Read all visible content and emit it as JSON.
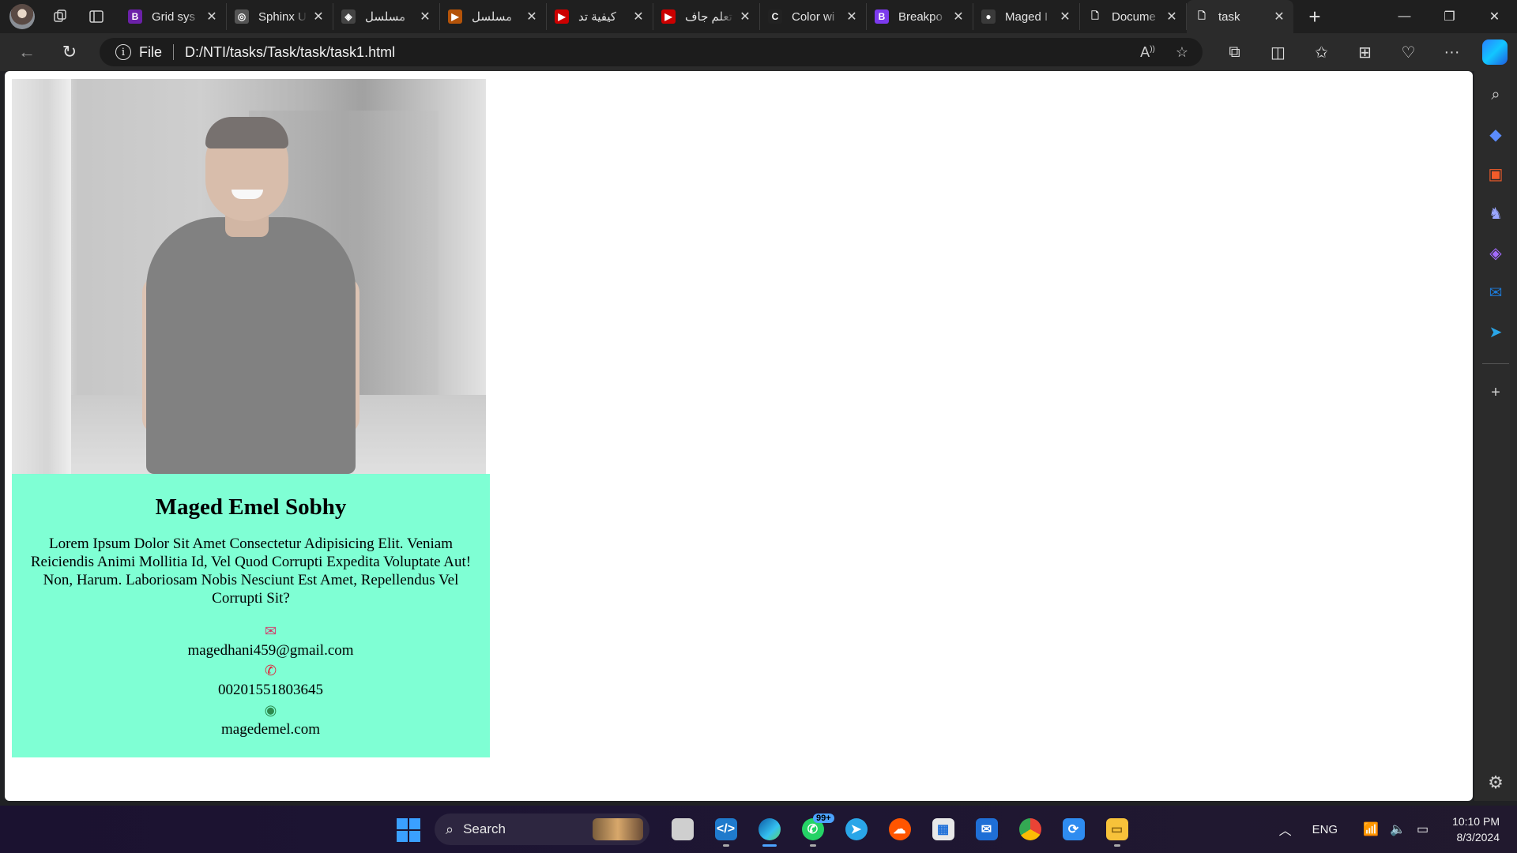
{
  "browser": {
    "tabs": [
      {
        "title": "Grid sys",
        "favicon": "bootstrap-icon",
        "fav_color": "#6b21a8",
        "fav_text": "B"
      },
      {
        "title": "Sphinx U",
        "favicon": "sphinx-icon",
        "fav_color": "#555555",
        "fav_text": "◎"
      },
      {
        "title": "مسلسل",
        "favicon": "dramas-icon",
        "fav_color": "#444444",
        "fav_text": "◈"
      },
      {
        "title": "مسلسل",
        "favicon": "play-icon",
        "fav_color": "#b45309",
        "fav_text": "▶"
      },
      {
        "title": "كيفية تد",
        "favicon": "youtube-icon",
        "fav_color": "#cc0000",
        "fav_text": "▶"
      },
      {
        "title": "تعلم جاف",
        "favicon": "youtube-icon",
        "fav_color": "#cc0000",
        "fav_text": "▶"
      },
      {
        "title": "Color wi",
        "favicon": "colorwheel-icon",
        "fav_color": "#222222",
        "fav_text": "C"
      },
      {
        "title": "Breakpo",
        "favicon": "bootstrap-icon",
        "fav_color": "#7c3aed",
        "fav_text": "B"
      },
      {
        "title": "Maged I",
        "favicon": "avatar-icon",
        "fav_color": "#3a3a3a",
        "fav_text": "●"
      },
      {
        "title": "Docume",
        "favicon": "page-icon",
        "fav_color": "transparent",
        "fav_text": "🗋"
      },
      {
        "title": "task",
        "favicon": "page-icon",
        "fav_color": "transparent",
        "fav_text": "🗋"
      }
    ],
    "address": {
      "scheme_label": "File",
      "url": "D:/NTI/tasks/Task/task/task1.html"
    }
  },
  "page": {
    "name": "Maged Emel Sobhy",
    "bio": "Lorem Ipsum Dolor Sit Amet Consectetur Adipisicing Elit. Veniam Reiciendis Animi Mollitia Id, Vel Quod Corrupti Expedita Voluptate Aut! Non, Harum. Laboriosam Nobis Nesciunt Est Amet, Repellendus Vel Corrupti Sit?",
    "email": "magedhani459@gmail.com",
    "phone": "00201551803645",
    "website": "magedemel.com",
    "card_color": "#7fffd4"
  },
  "taskbar": {
    "search_label": "Search",
    "whatsapp_badge": "99+",
    "language": "ENG",
    "time": "10:10 PM",
    "date": "8/3/2024"
  }
}
